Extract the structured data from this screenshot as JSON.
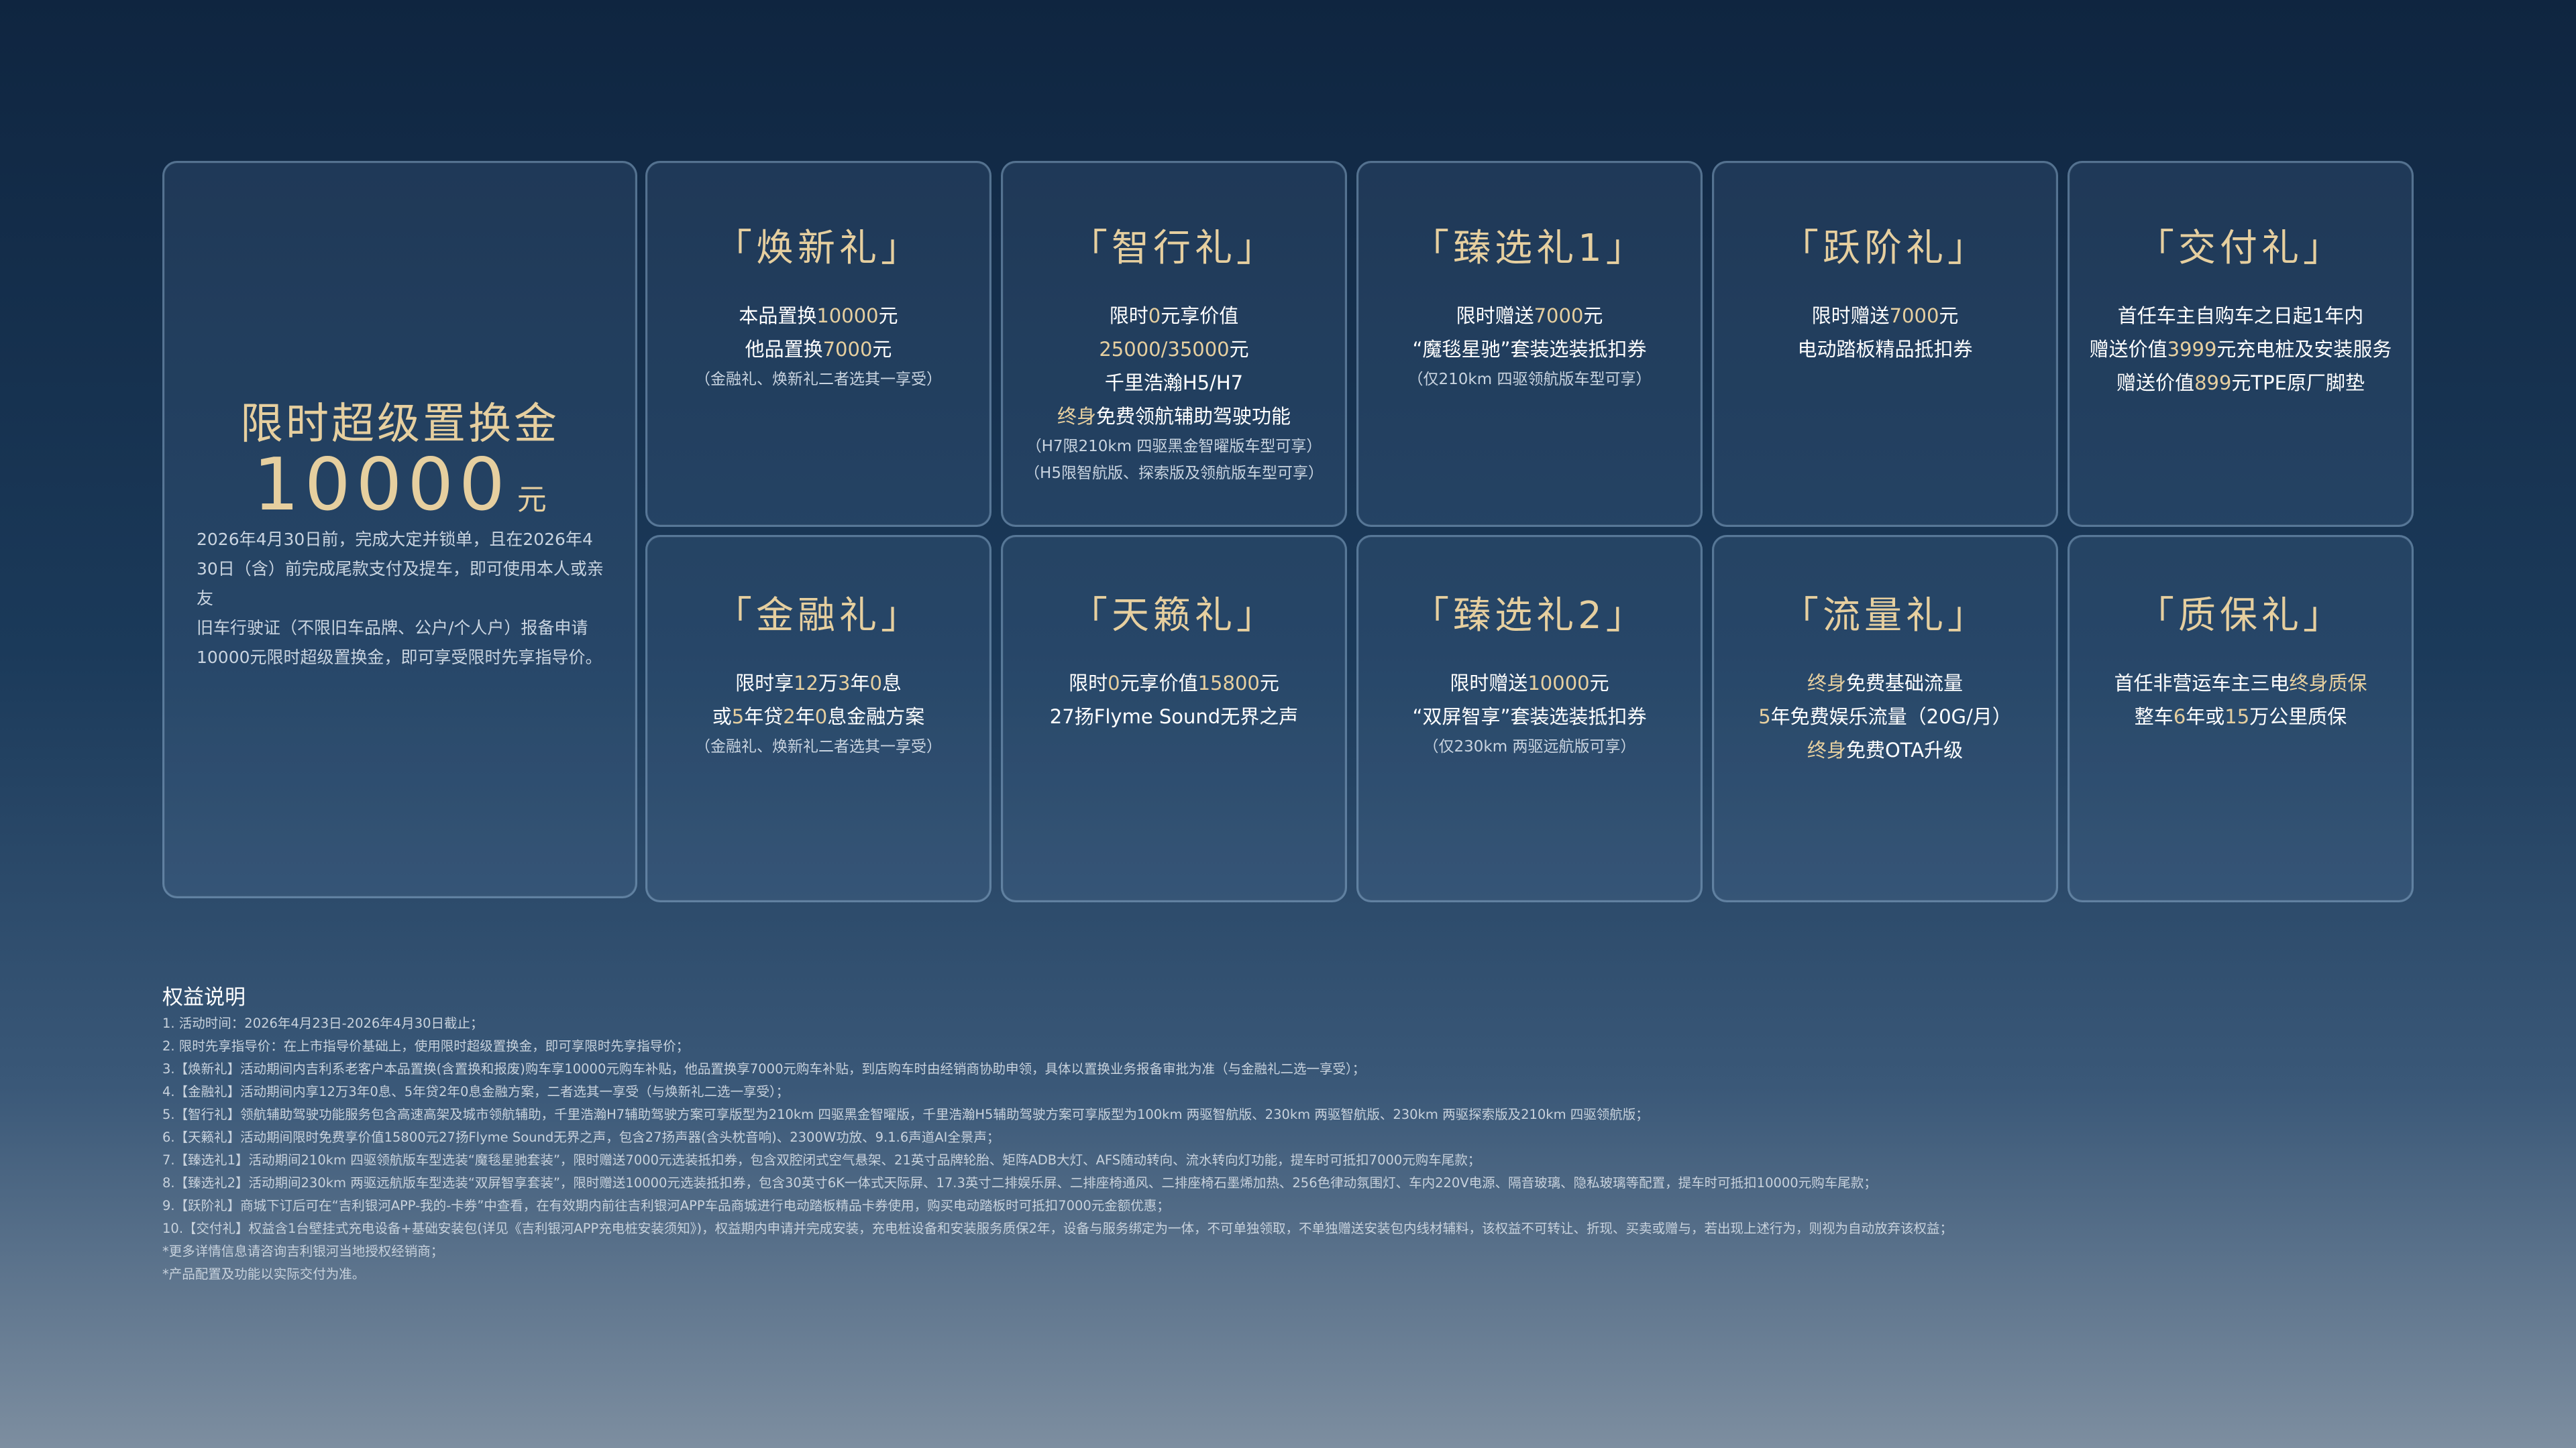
{
  "big_card": {
    "title": "限时超级置换金",
    "amount": "10000",
    "unit": "元",
    "desc_lines": [
      "2026年4月30日前，完成大定并锁单，且在2026年4",
      "30日（含）前完成尾款支付及提车，即可使用本人或亲友",
      "旧车行驶证（不限旧车品牌、公户/个人户）报备申请",
      "10000元限时超级置换金，即可享受限时先享指导价。"
    ]
  },
  "cards": [
    {
      "title": "「焕新礼」",
      "lines": [
        [
          {
            "t": "本品置换"
          },
          {
            "t": "10000",
            "hl": true
          },
          {
            "t": "元"
          }
        ],
        [
          {
            "t": "他品置换"
          },
          {
            "t": "7000",
            "hl": true
          },
          {
            "t": "元"
          }
        ]
      ],
      "notes": [
        "（金融礼、焕新礼二者选其一享受）"
      ]
    },
    {
      "title": "「智行礼」",
      "lines": [
        [
          {
            "t": "限时"
          },
          {
            "t": "0",
            "hl": true
          },
          {
            "t": "元享价值"
          }
        ],
        [
          {
            "t": "25000/35000",
            "hl": true
          },
          {
            "t": "元"
          }
        ],
        [
          {
            "t": "千里浩瀚H5/H7"
          }
        ],
        [
          {
            "t": "终身",
            "hl": true
          },
          {
            "t": "免费领航辅助驾驶功能"
          }
        ]
      ],
      "notes": [
        "（H7限210km 四驱黑金智曜版车型可享）",
        "（H5限智航版、探索版及领航版车型可享）"
      ]
    },
    {
      "title": "「臻选礼1」",
      "lines": [
        [
          {
            "t": "限时赠送"
          },
          {
            "t": "7000",
            "hl": true
          },
          {
            "t": "元"
          }
        ],
        [
          {
            "t": "“魔毯星驰”套装选装抵扣券"
          }
        ]
      ],
      "notes": [
        "（仅210km 四驱领航版车型可享）"
      ]
    },
    {
      "title": "「跃阶礼」",
      "lines": [
        [
          {
            "t": "限时赠送"
          },
          {
            "t": "7000",
            "hl": true
          },
          {
            "t": "元"
          }
        ],
        [
          {
            "t": "电动踏板精品抵扣券"
          }
        ]
      ],
      "notes": []
    },
    {
      "title": "「交付礼」",
      "lines": [
        [
          {
            "t": "首任车主自购车之日起1年内"
          }
        ],
        [
          {
            "t": "赠送价值"
          },
          {
            "t": "3999",
            "hl": true
          },
          {
            "t": "元充电桩及安装服务"
          }
        ],
        [
          {
            "t": "赠送价值"
          },
          {
            "t": "899",
            "hl": true
          },
          {
            "t": "元TPE原厂脚垫"
          }
        ]
      ],
      "notes": []
    },
    {
      "title": "「金融礼」",
      "lines": [
        [
          {
            "t": "限时享"
          },
          {
            "t": "12",
            "hl": true
          },
          {
            "t": "万"
          },
          {
            "t": "3",
            "hl": true
          },
          {
            "t": "年"
          },
          {
            "t": "0",
            "hl": true
          },
          {
            "t": "息"
          }
        ],
        [
          {
            "t": "或"
          },
          {
            "t": "5",
            "hl": true
          },
          {
            "t": "年贷"
          },
          {
            "t": "2",
            "hl": true
          },
          {
            "t": "年"
          },
          {
            "t": "0",
            "hl": true
          },
          {
            "t": "息金融方案"
          }
        ]
      ],
      "notes": [
        "（金融礼、焕新礼二者选其一享受）"
      ]
    },
    {
      "title": "「天籁礼」",
      "lines": [
        [
          {
            "t": "限时"
          },
          {
            "t": "0",
            "hl": true
          },
          {
            "t": "元享价值"
          },
          {
            "t": "15800",
            "hl": true
          },
          {
            "t": "元"
          }
        ],
        [
          {
            "t": "27扬Flyme Sound无界之声"
          }
        ]
      ],
      "notes": []
    },
    {
      "title": "「臻选礼2」",
      "lines": [
        [
          {
            "t": "限时赠送"
          },
          {
            "t": "10000",
            "hl": true
          },
          {
            "t": "元"
          }
        ],
        [
          {
            "t": "“双屏智享”套装选装抵扣券"
          }
        ]
      ],
      "notes": [
        "（仅230km 两驱远航版可享）"
      ]
    },
    {
      "title": "「流量礼」",
      "lines": [
        [
          {
            "t": "终身",
            "hl": true
          },
          {
            "t": "免费基础流量"
          }
        ],
        [
          {
            "t": "5",
            "hl": true
          },
          {
            "t": "年免费娱乐流量（20G/月）"
          }
        ],
        [
          {
            "t": "终身",
            "hl": true
          },
          {
            "t": "免费OTA升级"
          }
        ]
      ],
      "notes": []
    },
    {
      "title": "「质保礼」",
      "lines": [
        [
          {
            "t": "首任非营运车主三电"
          },
          {
            "t": "终身质保",
            "hl": true
          }
        ],
        [
          {
            "t": "整车"
          },
          {
            "t": "6",
            "hl": true
          },
          {
            "t": "年或"
          },
          {
            "t": "15",
            "hl": true
          },
          {
            "t": "万公里质保"
          }
        ]
      ],
      "notes": []
    }
  ],
  "footnotes": {
    "title": "权益说明",
    "items": [
      "1.   活动时间：2026年4月23日-2026年4月30日截止；",
      "2.   限时先享指导价：在上市指导价基础上，使用限时超级置换金，即可享限时先享指导价；",
      "3.【焕新礼】活动期间内吉利系老客户本品置换(含置换和报废)购车享10000元购车补贴，他品置换享7000元购车补贴，到店购车时由经销商协助申领，具体以置换业务报备审批为准（与金融礼二选一享受）；",
      "4.【金融礼】活动期间内享12万3年0息、5年贷2年0息金融方案，二者选其一享受（与焕新礼二选一享受）；",
      "5.【智行礼】领航辅助驾驶功能服务包含高速高架及城市领航辅助，千里浩瀚H7辅助驾驶方案可享版型为210km 四驱黑金智曜版，千里浩瀚H5辅助驾驶方案可享版型为100km 两驱智航版、230km 两驱智航版、230km 两驱探索版及210km 四驱领航版；",
      "6.【天籁礼】活动期间限时免费享价值15800元27扬Flyme Sound无界之声，包含27扬声器(含头枕音响)、2300W功放、9.1.6声道AI全景声；",
      "7.【臻选礼1】活动期间210km 四驱领航版车型选装“魔毯星驰套装”，限时赠送7000元选装抵扣券，包含双腔闭式空气悬架、21英寸品牌轮胎、矩阵ADB大灯、AFS随动转向、流水转向灯功能，提车时可抵扣7000元购车尾款；",
      "8.【臻选礼2】活动期间230km 两驱远航版车型选装“双屏智享套装”，限时赠送10000元选装抵扣券，包含30英寸6K一体式天际屏、17.3英寸二排娱乐屏、二排座椅通风、二排座椅石墨烯加热、256色律动氛围灯、车内220V电源、隔音玻璃、隐私玻璃等配置，提车时可抵扣10000元购车尾款；",
      "9.【跃阶礼】商城下订后可在“吉利银河APP-我的-卡券”中查看，在有效期内前往吉利银河APP车品商城进行电动踏板精品卡券使用，购买电动踏板时可抵扣7000元金额优惠；",
      "10.【交付礼】权益含1台壁挂式充电设备+基础安装包(详见《吉利银河APP充电桩安装须知》)，权益期内申请并完成安装，充电桩设备和安装服务质保2年，设备与服务绑定为一体，不可单独领取，不单独赠送安装包内线材辅料，该权益不可转让、折现、买卖或赠与，若出现上述行为，则视为自动放弃该权益；",
      "*更多详情信息请咨询吉利银河当地授权经销商；",
      "*产品配置及功能以实际交付为准。"
    ]
  }
}
